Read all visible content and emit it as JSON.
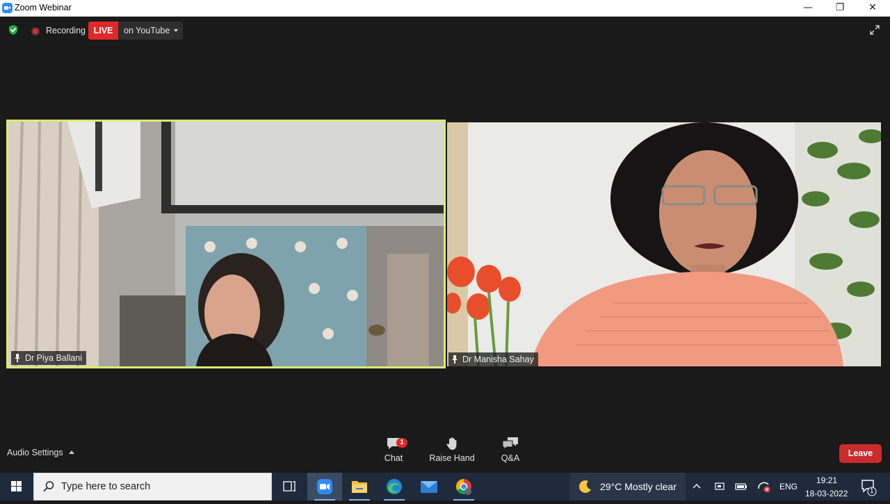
{
  "window": {
    "title": "Zoom Webinar",
    "minimize": "—",
    "restore": "❐",
    "close": "✕"
  },
  "top_bar": {
    "recording_label": "Recording",
    "live_badge": "LIVE",
    "live_target": "on YouTube"
  },
  "participants": [
    {
      "name": "Dr Piya Ballani",
      "active_speaker": true
    },
    {
      "name": "Dr Manisha Sahay",
      "active_speaker": false
    }
  ],
  "bottom_bar": {
    "audio_settings": "Audio Settings",
    "chat_label": "Chat",
    "chat_badge": "1",
    "raise_hand_label": "Raise Hand",
    "qa_label": "Q&A",
    "leave_label": "Leave"
  },
  "taskbar": {
    "search_placeholder": "Type here to search",
    "apps": [
      "task-view-icon",
      "zoom-icon",
      "file-explorer-icon",
      "edge-icon",
      "mail-icon",
      "chrome-icon"
    ],
    "weather": {
      "temp_text": "29°C  Mostly clear"
    },
    "language": "ENG",
    "time": "19:21",
    "date": "18-03-2022",
    "notification_count": "1"
  },
  "colors": {
    "active_speaker_border": "#d7ec73",
    "live_red": "#e02828",
    "leave_red": "#cc2b2b",
    "stage_bg": "#1a1a1a",
    "taskbar_bg": "#1f2b3d"
  }
}
